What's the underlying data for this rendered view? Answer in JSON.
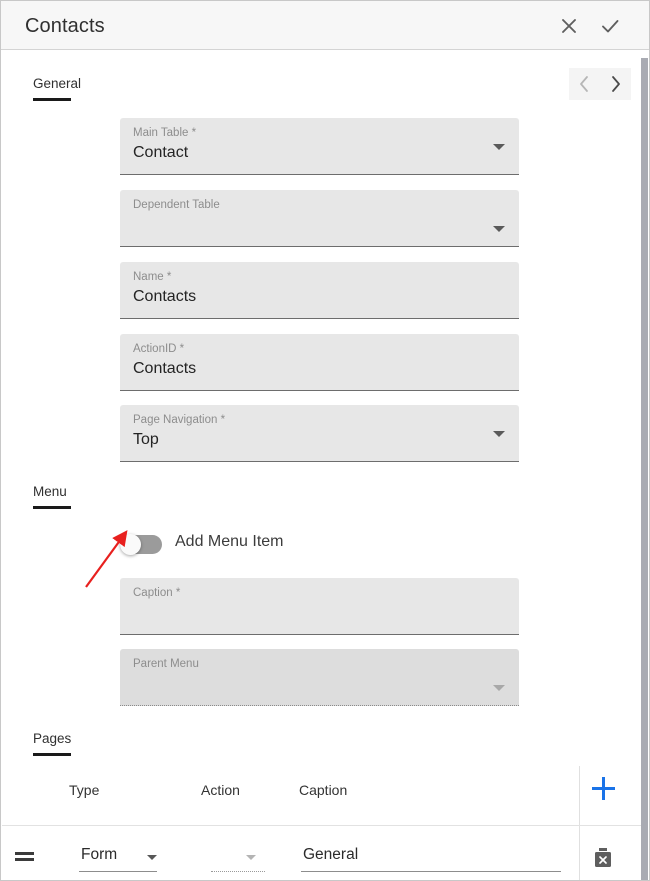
{
  "window": {
    "title": "Contacts",
    "close_icon": "close-icon",
    "confirm_icon": "check-icon"
  },
  "pager": {
    "prev_icon": "chevron-left-icon",
    "next_icon": "chevron-right-icon"
  },
  "sections": {
    "general": {
      "label": "General"
    },
    "menu": {
      "label": "Menu"
    },
    "pages": {
      "label": "Pages"
    }
  },
  "general_fields": [
    {
      "label": "Main Table *",
      "value": "Contact",
      "type": "select",
      "disabled": false,
      "caret": "chevron-down-icon"
    },
    {
      "label": "Dependent Table",
      "value": "",
      "type": "select",
      "disabled": false,
      "caret": "chevron-down-icon"
    },
    {
      "label": "Name *",
      "value": "Contacts",
      "type": "text",
      "disabled": false,
      "caret": ""
    },
    {
      "label": "ActionID *",
      "value": "Contacts",
      "type": "text",
      "disabled": false,
      "caret": ""
    },
    {
      "label": "Page Navigation *",
      "value": "Top",
      "type": "select",
      "disabled": false,
      "caret": "chevron-down-icon"
    }
  ],
  "menu_section": {
    "toggle": {
      "label": "Add Menu Item",
      "checked": false
    },
    "fields": [
      {
        "label": "Caption *",
        "value": "",
        "type": "text",
        "disabled": false,
        "caret": ""
      },
      {
        "label": "Parent Menu",
        "value": "",
        "type": "select",
        "disabled": true,
        "caret": "chevron-down-icon"
      }
    ]
  },
  "pages_table": {
    "columns": [
      "Type",
      "Action",
      "Caption"
    ],
    "add_icon": "plus-icon",
    "rows": [
      {
        "drag_icon": "drag-handle-icon",
        "type": "Form",
        "type_caret": "chevron-down-icon",
        "action": "",
        "action_caret": "chevron-down-icon",
        "caption": "General",
        "delete_icon": "delete-icon"
      }
    ]
  },
  "annotation": {
    "arrow_icon": "red-arrow-icon",
    "color": "#e8201e"
  },
  "colors": {
    "accent": "#1a73e8",
    "field_bg": "#e7e7e7",
    "field_bg_disabled": "#dddddd",
    "titlebar_bg": "#f7f7f7"
  }
}
